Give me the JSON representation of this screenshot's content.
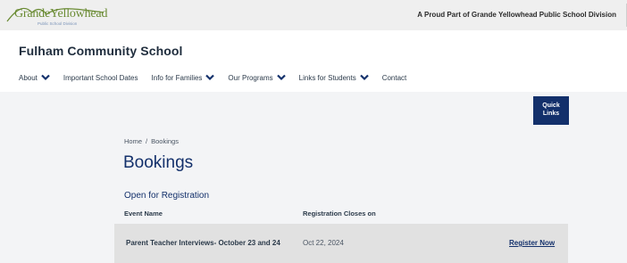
{
  "topbar": {
    "logo_name": "GrandeYellowhead",
    "logo_sub": "Public School Division",
    "division_text": "A Proud Part of Grande Yellowhead Public School Division"
  },
  "school": {
    "name": "Fulham Community School"
  },
  "nav": {
    "items": [
      {
        "label": "About",
        "has_dropdown": true
      },
      {
        "label": "Important School Dates",
        "has_dropdown": false
      },
      {
        "label": "Info for Families",
        "has_dropdown": true
      },
      {
        "label": "Our Programs",
        "has_dropdown": true
      },
      {
        "label": "Links for Students",
        "has_dropdown": true
      },
      {
        "label": "Contact",
        "has_dropdown": false
      }
    ]
  },
  "quick_links": {
    "line1": "Quick",
    "line2": "Links"
  },
  "breadcrumb": {
    "home": "Home",
    "separator": "/",
    "current": "Bookings"
  },
  "page": {
    "title": "Bookings"
  },
  "section": {
    "title": "Open for Registration",
    "columns": {
      "event_name": "Event Name",
      "closes_on": "Registration Closes on"
    },
    "rows": [
      {
        "event": "Parent Teacher Interviews- October 23 and 24",
        "closes": "Oct 22, 2024",
        "action": "Register Now"
      }
    ]
  },
  "colors": {
    "navy": "#13306b",
    "logo_green": "#6a8b33",
    "topbar_bg": "#efefef",
    "content_bg": "#f3f4f6",
    "row_bg": "#e1e1e1"
  }
}
